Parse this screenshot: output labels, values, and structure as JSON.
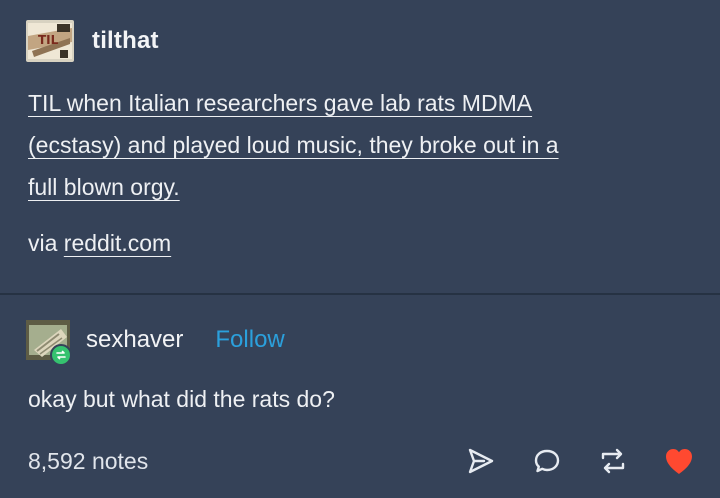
{
  "post": {
    "username": "tilthat",
    "avatar_text": "TIL",
    "text_lines": [
      "TIL when Italian researchers gave lab rats MDMA",
      "(ecstasy) and played loud music, they broke out in a",
      "full blown orgy."
    ],
    "via_prefix": "via",
    "via_link": "reddit.com"
  },
  "reply": {
    "username": "sexhaver",
    "follow_label": "Follow",
    "text": "okay but what did the rats do?"
  },
  "footer": {
    "notes": "8,592 notes"
  },
  "icons": {
    "share": "share-arrow-icon",
    "comment": "comment-bubble-icon",
    "reblog": "reblog-icon",
    "like": "heart-icon"
  },
  "colors": {
    "background": "#354258",
    "follow": "#2ba0dc",
    "heart": "#ff4930",
    "reblog_badge": "#35c26f"
  }
}
